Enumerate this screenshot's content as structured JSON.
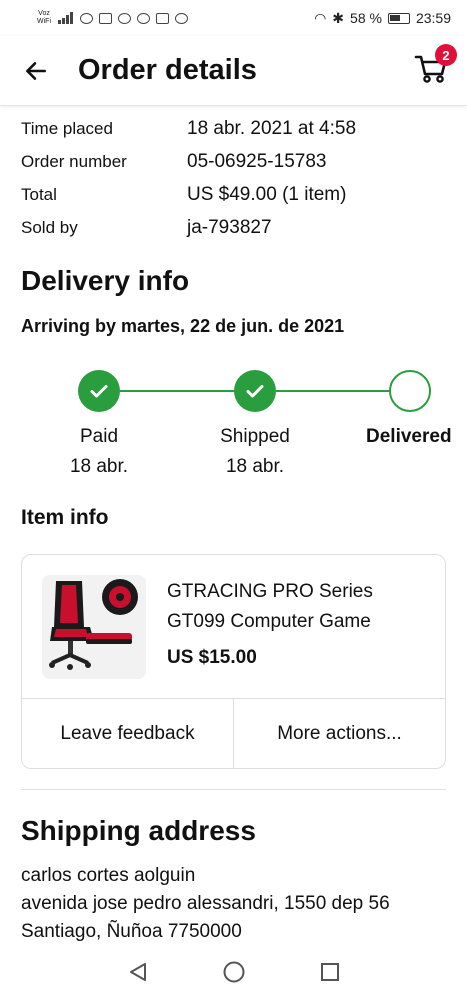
{
  "status_bar": {
    "carrier": "Voz WiFi",
    "battery": "58 %",
    "time": "23:59"
  },
  "header": {
    "title": "Order details",
    "cart_count": "2"
  },
  "order": {
    "rows": [
      {
        "label": "Time placed",
        "value": "18 abr. 2021 at 4:58"
      },
      {
        "label": "Order number",
        "value": "05-06925-15783"
      },
      {
        "label": "Total",
        "value": "US $49.00 (1 item)"
      },
      {
        "label": "Sold by",
        "value": "ja-793827"
      }
    ]
  },
  "delivery": {
    "heading": "Delivery info",
    "arriving": "Arriving by martes, 22 de jun. de 2021",
    "steps": [
      {
        "label": "Paid",
        "date": "18 abr.",
        "done": true
      },
      {
        "label": "Shipped",
        "date": "18 abr.",
        "done": true
      },
      {
        "label": "Delivered",
        "date": "",
        "done": false
      }
    ],
    "accent": "#2a9d3f"
  },
  "item": {
    "heading": "Item info",
    "title": "GTRACING PRO Series GT099 Computer Game",
    "price": "US $15.00",
    "actions": [
      "Leave feedback",
      "More actions..."
    ]
  },
  "shipping": {
    "heading": "Shipping address",
    "lines": [
      "carlos cortes aolguin",
      "avenida jose pedro alessandri, 1550 dep 56",
      "Santiago, Ñuñoa 7750000"
    ]
  },
  "icons": [
    "back-arrow-icon",
    "cart-icon",
    "check-icon",
    "nav-back-icon",
    "nav-home-icon",
    "nav-recents-icon"
  ]
}
